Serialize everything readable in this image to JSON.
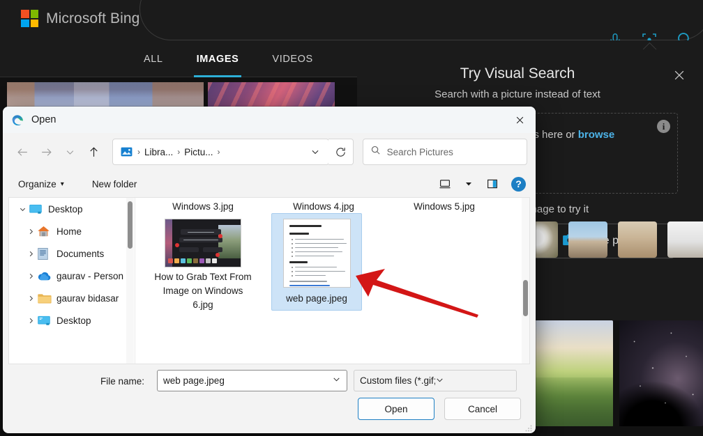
{
  "bing": {
    "brand": "Microsoft Bing",
    "logo_colors": [
      "#f25022",
      "#7fba00",
      "#00a4ef",
      "#ffb900"
    ],
    "header_icons": [
      {
        "name": "microphone-icon",
        "label": "Search using voice"
      },
      {
        "name": "visual-search-icon",
        "label": "Search using an image"
      },
      {
        "name": "search-icon",
        "label": "Search"
      }
    ],
    "accent": "#2dafd6",
    "tabs": [
      {
        "label": "ALL",
        "active": false
      },
      {
        "label": "IMAGES",
        "active": true
      },
      {
        "label": "VIDEOS",
        "active": false
      }
    ]
  },
  "visual_search": {
    "title": "Try Visual Search",
    "subtitle": "Search with a picture instead of text",
    "drop_text_prefix": "Drag one or more images here or ",
    "browse_label": "browse",
    "info_label": "i",
    "take_photo_label": "Take photo",
    "hint": "Or use a sample image to try it",
    "close_label": "×",
    "samples": [
      {
        "name": "sample-rose"
      },
      {
        "name": "sample-louvre"
      },
      {
        "name": "sample-dogs"
      },
      {
        "name": "sample-chair"
      }
    ]
  },
  "dialog": {
    "title": "Open",
    "close_label": "×",
    "nav": {
      "back_tooltip": "Back",
      "forward_tooltip": "Forward",
      "recent_tooltip": "Recent locations",
      "up_tooltip": "Up",
      "refresh_tooltip": "Refresh"
    },
    "breadcrumb": {
      "icon": "pictures-folder-icon",
      "items": [
        "Libra...",
        "Pictu..."
      ],
      "separator": "›"
    },
    "search": {
      "placeholder": "Search Pictures",
      "value": "",
      "icon": "search-icon"
    },
    "toolbar": {
      "organize_label": "Organize",
      "organize_caret": "▾",
      "new_folder_label": "New folder",
      "view_icon": "view-layout-icon",
      "view_caret": "▾",
      "preview_pane_icon": "preview-pane-icon",
      "help_label": "?"
    },
    "tree": [
      {
        "label": "Desktop",
        "icon": "desktop-icon",
        "level": 1,
        "expanded": true,
        "chevron": "⌄"
      },
      {
        "label": "Home",
        "icon": "home-icon",
        "level": 2,
        "expanded": false,
        "chevron": "›"
      },
      {
        "label": "Documents",
        "icon": "documents-icon",
        "level": 2,
        "expanded": false,
        "chevron": "›"
      },
      {
        "label": "gaurav - Person",
        "icon": "onedrive-icon",
        "level": 2,
        "expanded": false,
        "chevron": "›"
      },
      {
        "label": "gaurav bidasar",
        "icon": "folder-icon",
        "level": 2,
        "expanded": false,
        "chevron": "›"
      },
      {
        "label": "Desktop",
        "icon": "desktop-icon",
        "level": 2,
        "expanded": false,
        "chevron": "›"
      }
    ],
    "files": {
      "partial_top_row": [
        "Windows 3.jpg",
        "Windows 4.jpg",
        "Windows 5.jpg"
      ],
      "row": [
        {
          "label": "How to Grab Text From Image on Windows 6.jpg",
          "thumb": "screenshot-thumb",
          "selected": false
        },
        {
          "label": "web page.jpeg",
          "thumb": "document-thumb",
          "selected": true
        }
      ]
    },
    "file_name": {
      "label": "File name:",
      "value": "web page.jpeg",
      "caret": "⌄"
    },
    "file_type": {
      "value": "Custom files (*.gif;*.jfif;*.pjpeg;*",
      "caret": "⌄"
    },
    "buttons": {
      "open_label": "Open",
      "cancel_label": "Cancel"
    }
  },
  "annotation": {
    "arrow_color": "#d31616",
    "points_to": "web page.jpeg"
  }
}
